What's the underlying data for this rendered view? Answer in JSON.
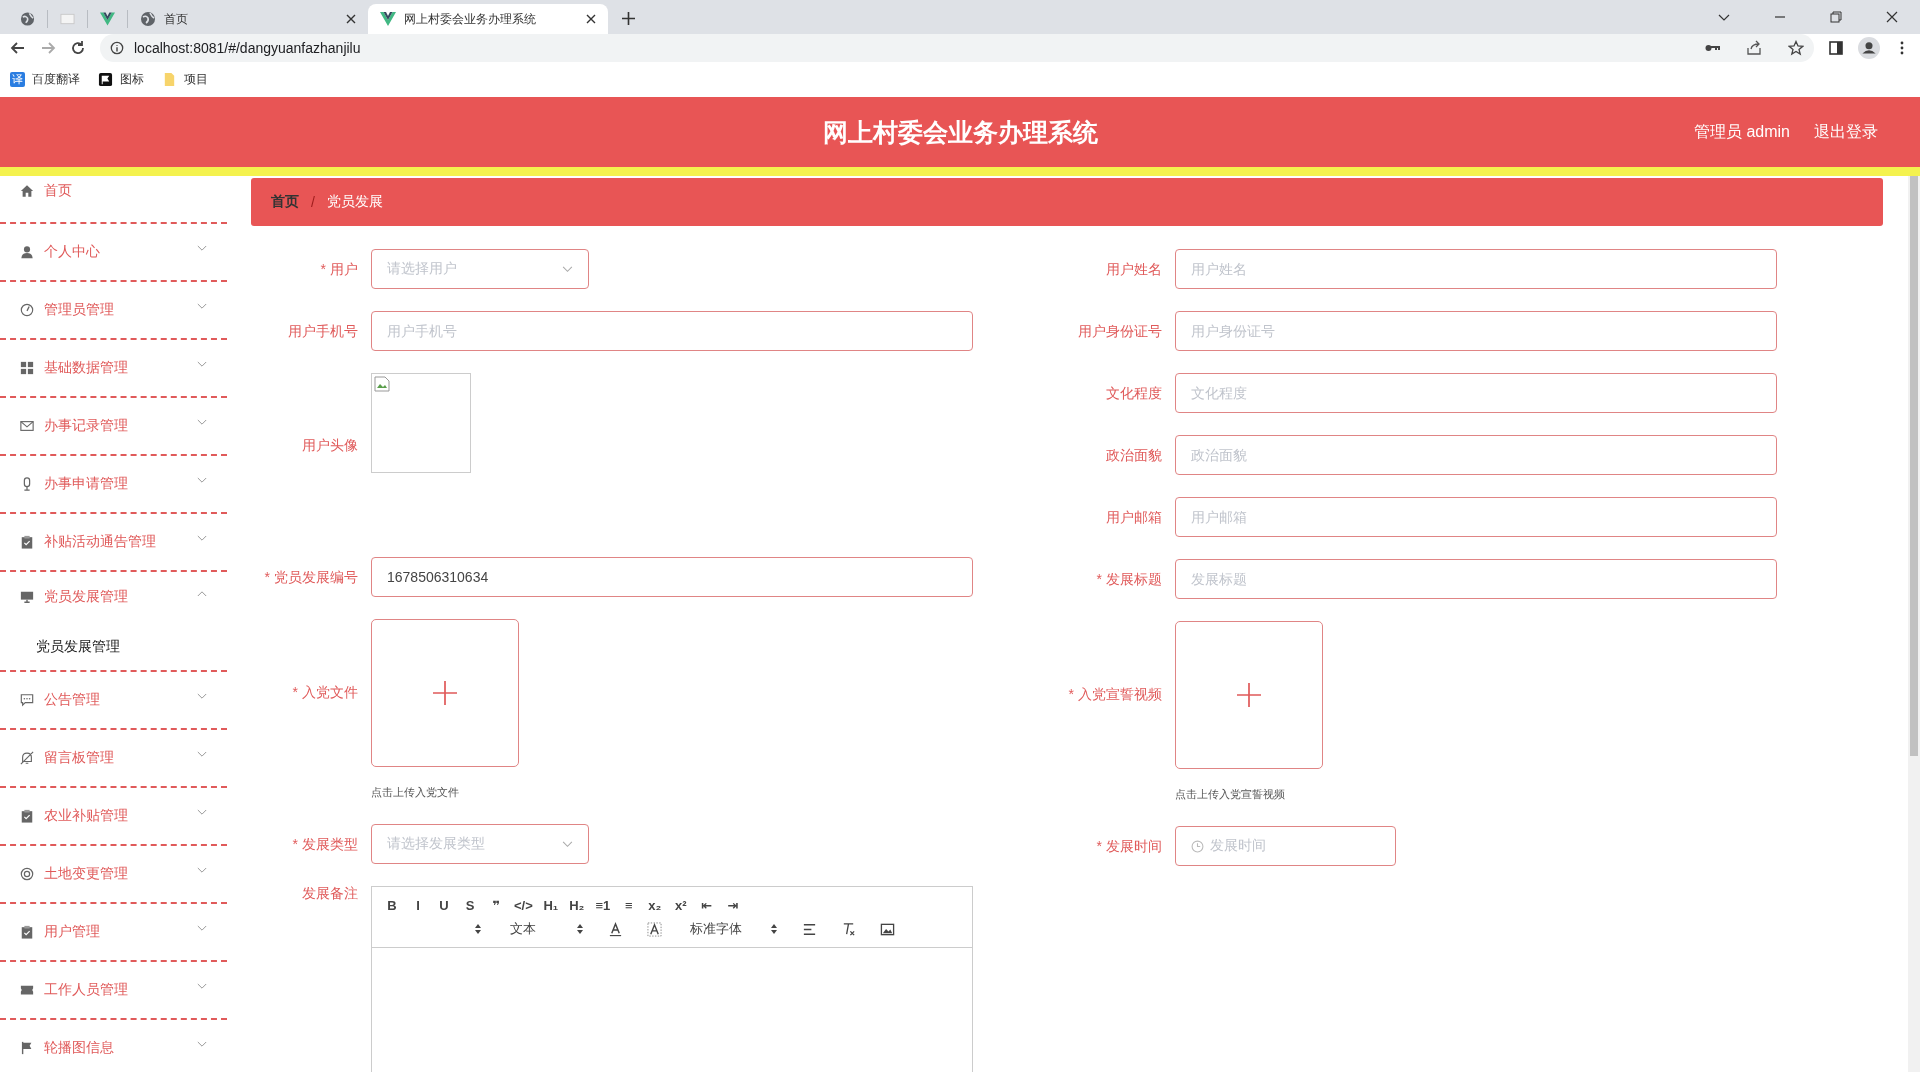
{
  "browser": {
    "tabs": [
      {
        "kind": "globe",
        "selected": false
      },
      {
        "kind": "blank",
        "selected": false
      },
      {
        "kind": "vue",
        "selected": false
      },
      {
        "kind": "globe",
        "title": "首页",
        "selected": false
      },
      {
        "kind": "vue",
        "title": "网上村委会业务办理系统",
        "selected": true
      }
    ],
    "url": "localhost:8081/#/dangyuanfazhanjilu",
    "bookmarks": [
      {
        "kind": "translate",
        "icon_text": "译",
        "label": "百度翻译"
      },
      {
        "kind": "flag",
        "label": "图标"
      },
      {
        "kind": "folder",
        "label": "项目"
      }
    ]
  },
  "header": {
    "title": "网上村委会业务办理系统",
    "user": "管理员 admin",
    "logout": "退出登录"
  },
  "sidebar": {
    "items": [
      {
        "label": "首页",
        "kind": "link"
      },
      {
        "label": "个人中心",
        "kind": "menu",
        "expanded": false
      },
      {
        "label": "管理员管理",
        "kind": "menu",
        "expanded": false
      },
      {
        "label": "基础数据管理",
        "kind": "menu",
        "expanded": false
      },
      {
        "label": "办事记录管理",
        "kind": "menu",
        "expanded": false
      },
      {
        "label": "办事申请管理",
        "kind": "menu",
        "expanded": false
      },
      {
        "label": "补贴活动通告管理",
        "kind": "menu",
        "expanded": false
      },
      {
        "label": "党员发展管理",
        "kind": "menu",
        "expanded": true,
        "children": [
          {
            "label": "党员发展管理"
          }
        ]
      },
      {
        "label": "公告管理",
        "kind": "menu",
        "expanded": false
      },
      {
        "label": "留言板管理",
        "kind": "menu",
        "expanded": false
      },
      {
        "label": "农业补贴管理",
        "kind": "menu",
        "expanded": false
      },
      {
        "label": "土地变更管理",
        "kind": "menu",
        "expanded": false
      },
      {
        "label": "用户管理",
        "kind": "menu",
        "expanded": false
      },
      {
        "label": "工作人员管理",
        "kind": "menu",
        "expanded": false
      },
      {
        "label": "轮播图信息",
        "kind": "menu",
        "expanded": false
      }
    ]
  },
  "breadcrumb": {
    "separator": "/",
    "items": [
      "首页",
      "党员发展"
    ]
  },
  "form": {
    "required_mark": "*",
    "left": [
      {
        "kind": "select",
        "label": "用户",
        "required": true,
        "placeholder": "请选择用户"
      },
      {
        "kind": "input",
        "label": "用户手机号",
        "required": false,
        "placeholder": "用户手机号"
      },
      {
        "kind": "image",
        "label": "用户头像",
        "required": false
      },
      {
        "kind": "input",
        "label": "党员发展编号",
        "required": true,
        "value": "1678506310634"
      },
      {
        "kind": "upload",
        "label": "入党文件",
        "required": true,
        "hint": "点击上传入党文件"
      },
      {
        "kind": "select",
        "label": "发展类型",
        "required": true,
        "placeholder": "请选择发展类型"
      },
      {
        "kind": "editor",
        "label": "发展备注",
        "required": false,
        "toolbar": {
          "row1": [
            "B",
            "I",
            "U",
            "S",
            "❞",
            "</>",
            "H₁",
            "H₂",
            "≡1",
            "≡",
            "x₂",
            "x²",
            "⇤",
            "⇥"
          ],
          "size": "文本",
          "font": "标准字体"
        }
      }
    ],
    "right": [
      {
        "kind": "input",
        "label": "用户姓名",
        "required": false,
        "placeholder": "用户姓名"
      },
      {
        "kind": "input",
        "label": "用户身份证号",
        "required": false,
        "placeholder": "用户身份证号"
      },
      {
        "kind": "input",
        "label": "文化程度",
        "required": false,
        "placeholder": "文化程度"
      },
      {
        "kind": "input",
        "label": "政治面貌",
        "required": false,
        "placeholder": "政治面貌"
      },
      {
        "kind": "input",
        "label": "用户邮箱",
        "required": false,
        "placeholder": "用户邮箱"
      },
      {
        "kind": "input",
        "label": "发展标题",
        "required": true,
        "placeholder": "发展标题"
      },
      {
        "kind": "upload",
        "label": "入党宣誓视频",
        "required": true,
        "hint": "点击上传入党宣誓视频"
      },
      {
        "kind": "date",
        "label": "发展时间",
        "required": true,
        "placeholder": "发展时间"
      }
    ]
  }
}
